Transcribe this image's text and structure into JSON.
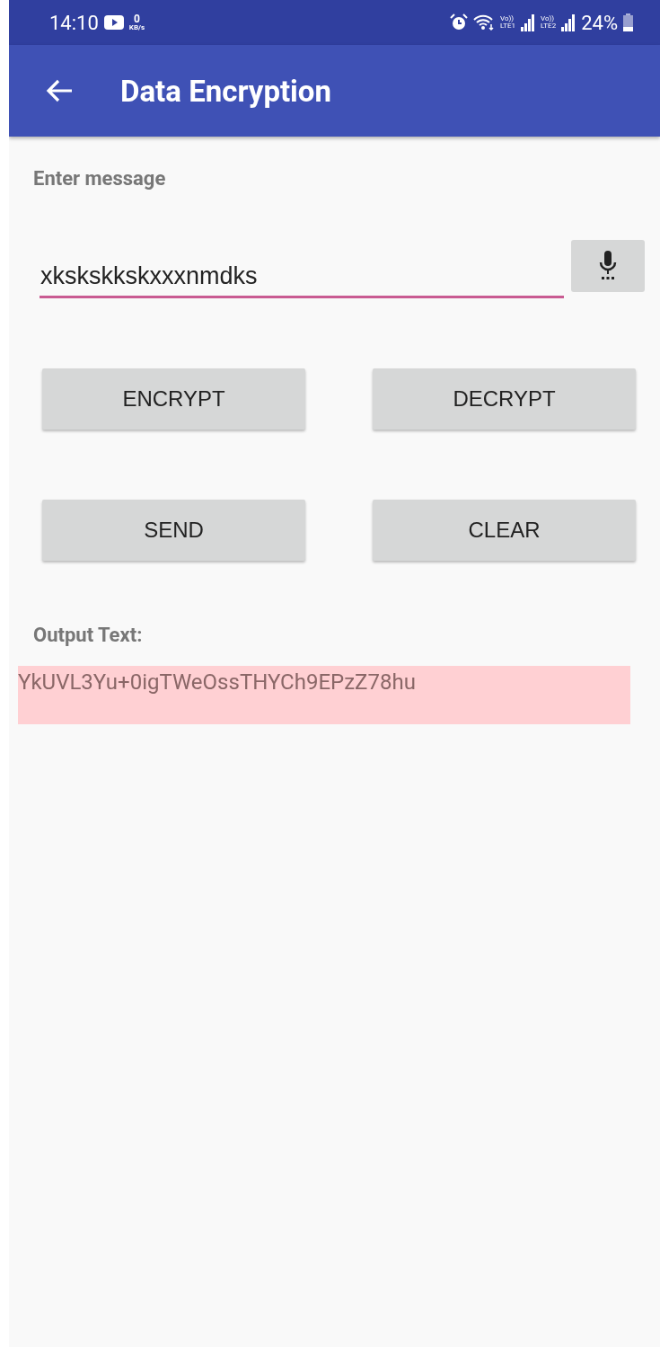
{
  "status_bar": {
    "time": "14:10",
    "net_speed": "0",
    "net_unit": "KB/s",
    "sim1_volte": "Vo))",
    "sim1_label": "LTE1",
    "sim2_volte": "Vo))",
    "sim2_label": "LTE2",
    "battery": "24%"
  },
  "app_bar": {
    "title": "Data Encryption"
  },
  "message_label": "Enter message",
  "message_field": {
    "value": "xkskskkskxxxnmdks"
  },
  "buttons": [
    {
      "label": "ENCRYPT"
    },
    {
      "label": "DECRYPT"
    },
    {
      "label": "SEND"
    },
    {
      "label": "CLEAR"
    }
  ],
  "output_label": "Output Text:",
  "output_text": "YkUVL3Yu+0igTWeOssTHYCh9EPzZ78hu"
}
